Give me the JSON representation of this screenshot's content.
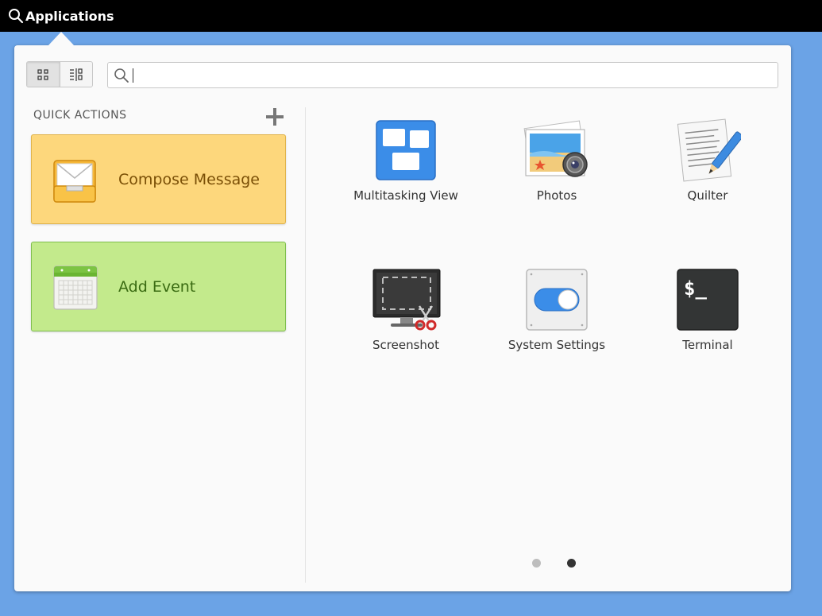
{
  "topbar": {
    "title": "Applications",
    "search_icon": "search-icon"
  },
  "toolbar": {
    "grid_view_icon": "grid-view-icon",
    "category_view_icon": "category-view-icon",
    "search": {
      "value": "",
      "placeholder": ""
    }
  },
  "quick_actions": {
    "label": "QUICK ACTIONS",
    "add_icon": "plus-icon",
    "items": [
      {
        "label": "Compose Message",
        "icon": "mail-inbox-icon",
        "color": "#fdd77c"
      },
      {
        "label": "Add Event",
        "icon": "calendar-icon",
        "color": "#c3ea8c"
      }
    ]
  },
  "apps": [
    {
      "name": "Multitasking View",
      "icon": "multitasking-view-icon"
    },
    {
      "name": "Photos",
      "icon": "photos-icon"
    },
    {
      "name": "Quilter",
      "icon": "quilter-icon"
    },
    {
      "name": "Screenshot",
      "icon": "screenshot-icon"
    },
    {
      "name": "System Settings",
      "icon": "system-settings-icon"
    },
    {
      "name": "Terminal",
      "icon": "terminal-icon"
    }
  ],
  "terminal_prompt": "$_",
  "pagination": {
    "pages": 2,
    "current": 2
  },
  "colors": {
    "desktop_bg": "#6ba3e6",
    "compose_bg": "#fdd77c",
    "event_bg": "#c3ea8c"
  }
}
